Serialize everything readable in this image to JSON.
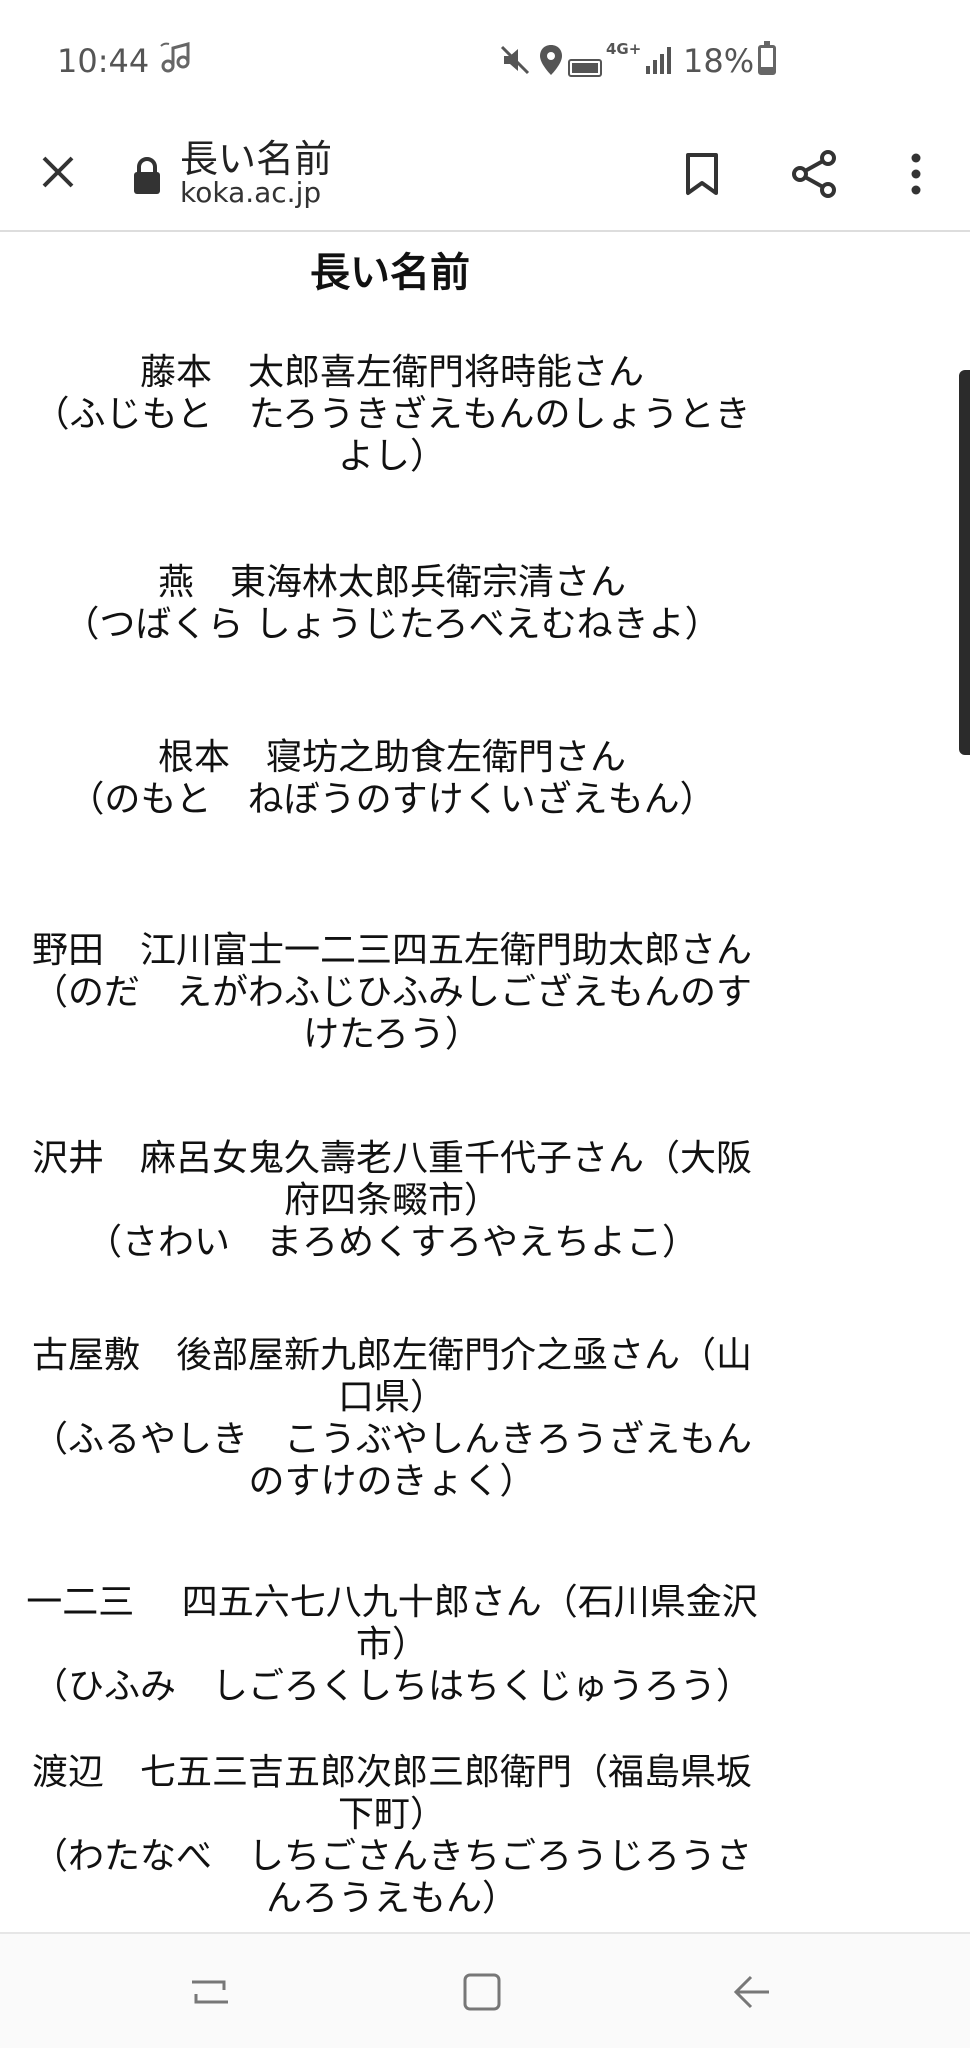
{
  "status_bar": {
    "time": "10:44",
    "battery_percent": "18%",
    "network_label": "4G+",
    "icons": [
      "music-note-icon",
      "mute-icon",
      "location-icon",
      "volte-icon",
      "network-icon",
      "signal-icon",
      "battery-icon"
    ]
  },
  "toolbar": {
    "page_title": "長い名前",
    "domain": "koka.ac.jp",
    "icons": [
      "close-icon",
      "lock-icon",
      "bookmark-icon",
      "share-icon",
      "more-icon"
    ]
  },
  "content": {
    "heading": "長い名前",
    "entries": [
      {
        "lines": [
          "藤本　太郎喜左衛門将時能さん",
          "（ふじもと　たろうきざえもんのしょうとき",
          "よし）"
        ]
      },
      {
        "lines": [
          "燕　東海林太郎兵衛宗清さん",
          "（つばくら しょうじたろべえむねきよ）"
        ]
      },
      {
        "lines": [
          "根本　寝坊之助食左衛門さん",
          "（のもと　ねぼうのすけくいざえもん）"
        ]
      },
      {
        "lines": [
          "野田　江川富士一二三四五左衛門助太郎さん",
          "（のだ　えがわふじひふみしござえもんのす",
          "けたろう）"
        ]
      },
      {
        "lines": [
          "沢井　麻呂女鬼久壽老八重千代子さん（大阪",
          "府四条畷市）",
          "（さわい　まろめくすろやえちよこ）"
        ]
      },
      {
        "lines": [
          "古屋敷　後部屋新九郎左衛門介之亟さん（山",
          "口県）",
          "（ふるやしき　こうぶやしんきろうざえもん",
          "のすけのきょく）"
        ]
      },
      {
        "lines": [
          "一二三　 四五六七八九十郎さん（石川県金沢",
          "市）",
          "（ひふみ　しごろくしちはちくじゅうろう）"
        ]
      },
      {
        "lines": [
          "渡辺　七五三吉五郎次郎三郎衛門（福島県坂",
          "下町）",
          "（わたなべ　しちごさんきちごろうじろうさ",
          "んろうえもん）"
        ]
      }
    ]
  },
  "nav_bar": {
    "icons": [
      "recent-apps-icon",
      "home-icon",
      "back-icon"
    ]
  }
}
